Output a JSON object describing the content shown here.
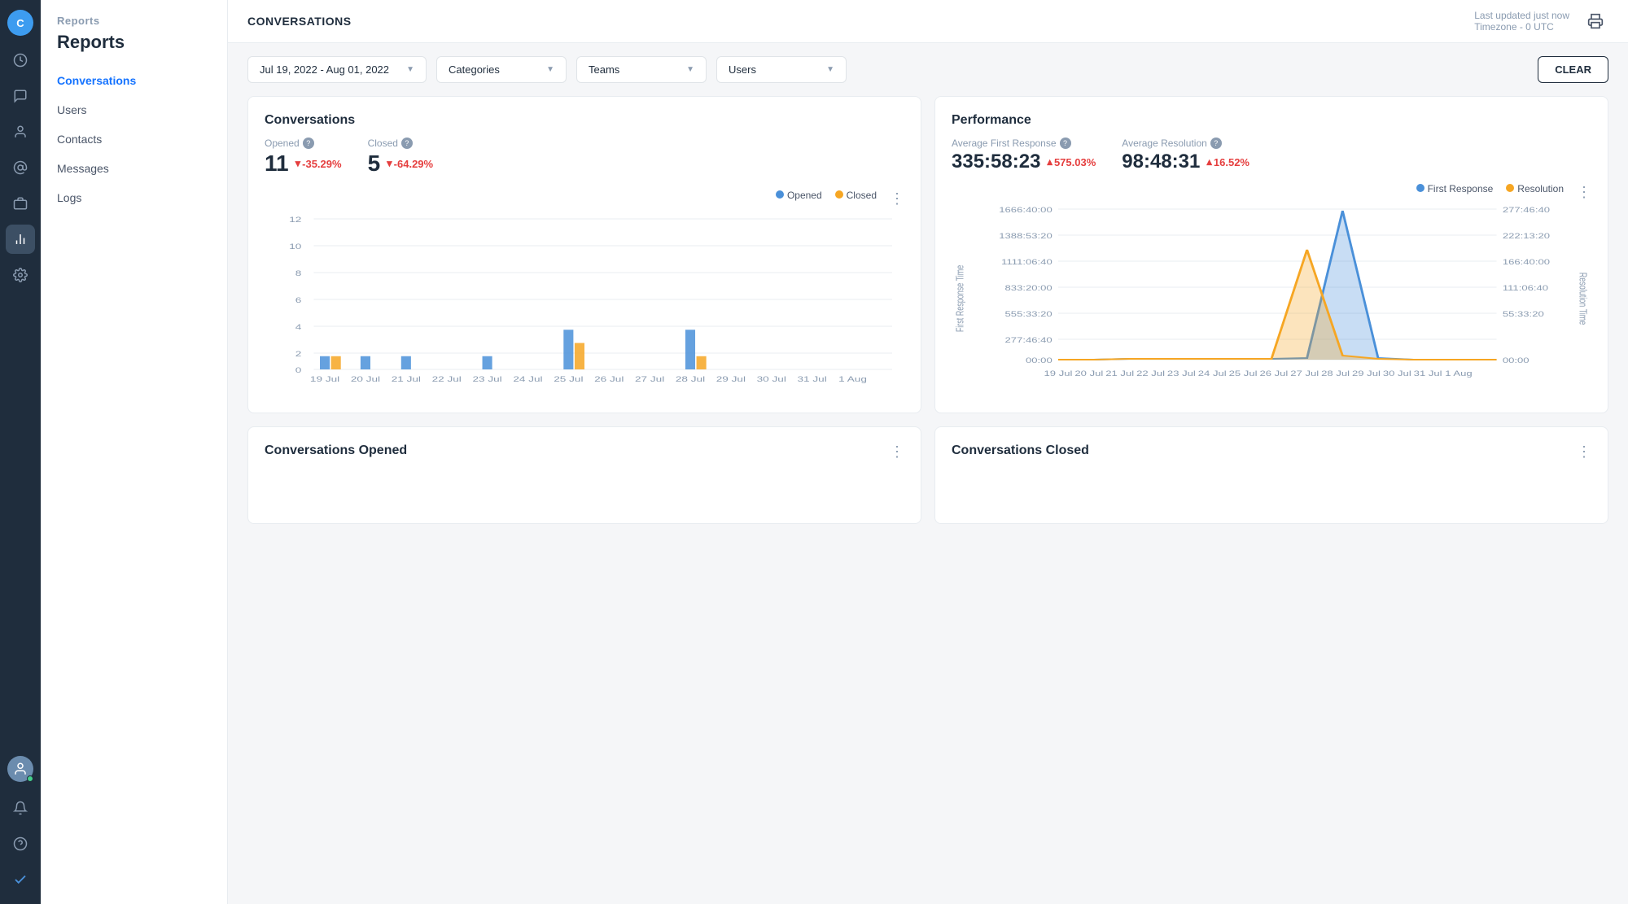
{
  "app": {
    "page_title": "CONVERSATIONS",
    "last_updated": "Last updated just now",
    "timezone": "Timezone - 0 UTC"
  },
  "sidebar_icon": {
    "avatar_initial": "C"
  },
  "nav": {
    "section_label": "Reports",
    "items": [
      {
        "id": "conversations",
        "label": "Conversations",
        "active": true
      },
      {
        "id": "users",
        "label": "Users",
        "active": false
      },
      {
        "id": "contacts",
        "label": "Contacts",
        "active": false
      },
      {
        "id": "messages",
        "label": "Messages",
        "active": false
      },
      {
        "id": "logs",
        "label": "Logs",
        "active": false
      }
    ]
  },
  "filters": {
    "date_range": "Jul 19, 2022 - Aug 01, 2022",
    "categories_placeholder": "Categories",
    "teams_placeholder": "Teams",
    "users_placeholder": "Users",
    "clear_label": "CLEAR"
  },
  "conversations_card": {
    "title": "Conversations",
    "opened_label": "Opened",
    "closed_label": "Closed",
    "opened_value": "11",
    "closed_value": "5",
    "opened_change": "-35.29%",
    "closed_change": "-64.29%",
    "legend_opened": "Opened",
    "legend_closed": "Closed",
    "chart_max": 12,
    "chart_dates": [
      "19 Jul",
      "20 Jul",
      "21 Jul",
      "22 Jul",
      "23 Jul",
      "24 Jul",
      "25 Jul",
      "26 Jul",
      "27 Jul",
      "28 Jul",
      "29 Jul",
      "30 Jul",
      "31 Jul",
      "1 Aug"
    ],
    "opened_bars": [
      0,
      1,
      1,
      0,
      1,
      0,
      3,
      0,
      0,
      3,
      0,
      0,
      0,
      0
    ],
    "closed_bars": [
      1,
      0,
      0,
      0,
      0,
      0,
      2,
      0,
      0,
      1,
      0,
      0,
      0,
      0
    ]
  },
  "performance_card": {
    "title": "Performance",
    "avg_first_response_label": "Average First Response",
    "avg_resolution_label": "Average Resolution",
    "avg_first_response_value": "335:58:23",
    "avg_resolution_value": "98:48:31",
    "avg_first_response_change": "575.03%",
    "avg_resolution_change": "16.52%",
    "legend_first_response": "First Response",
    "legend_resolution": "Resolution",
    "left_y_labels": [
      "1666:40:00",
      "1388:53:20",
      "1111:06:40",
      "833:20:00",
      "555:33:20",
      "277:46:40",
      "00:00"
    ],
    "right_y_labels": [
      "277:46:40",
      "222:13:20",
      "166:40:00",
      "111:06:40",
      "55:33:20",
      "00:00"
    ]
  },
  "conversations_opened_card": {
    "title": "Conversations Opened"
  },
  "conversations_closed_card": {
    "title": "Conversations Closed"
  }
}
